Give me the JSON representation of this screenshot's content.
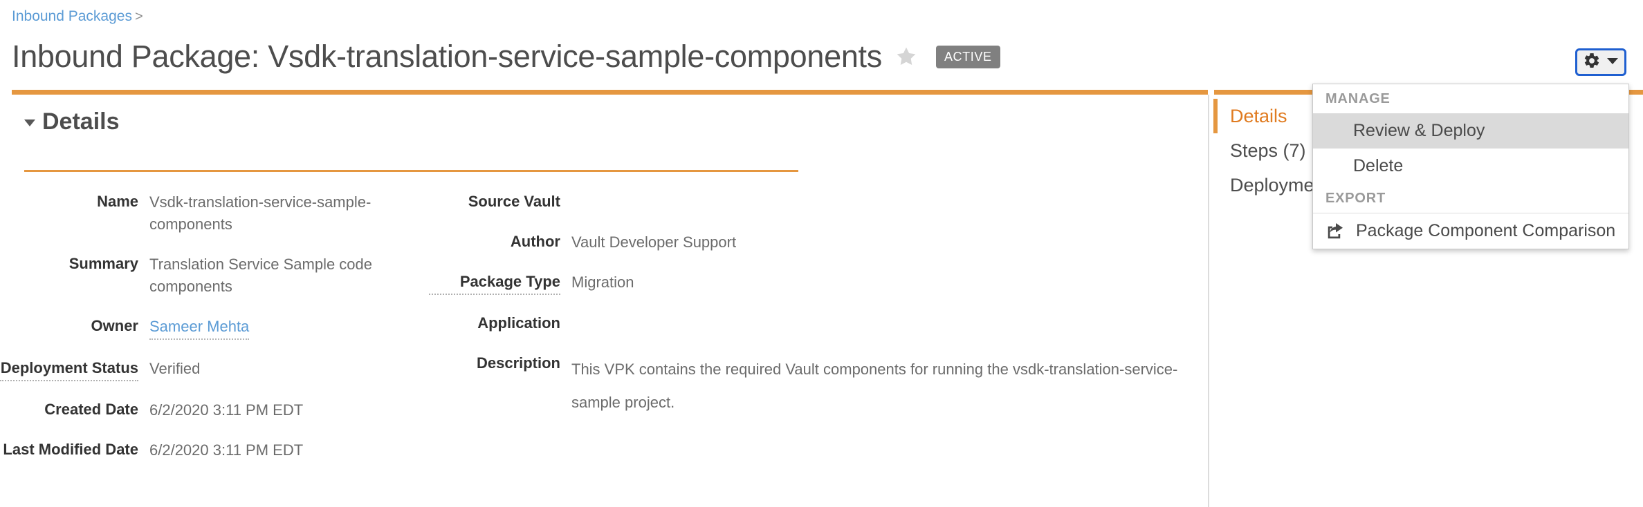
{
  "breadcrumb": {
    "link_label": "Inbound Packages",
    "separator": ">"
  },
  "header": {
    "title": "Inbound Package: Vsdk-translation-service-sample-components",
    "favorite_icon": "star-icon",
    "status_badge": "ACTIVE",
    "actions_button": {
      "gear_icon": "gear-icon",
      "caret_icon": "chevron-down-icon"
    }
  },
  "details": {
    "section_title": "Details",
    "collapse_icon": "caret-down-icon",
    "left_fields": [
      {
        "label": "Name",
        "value": "Vsdk-translation-service-sample-components",
        "style": "text",
        "tooltip": false
      },
      {
        "label": "Summary",
        "value": "Translation Service Sample code components",
        "style": "text",
        "tooltip": false
      },
      {
        "label": "Owner",
        "value": "Sameer Mehta",
        "style": "link",
        "tooltip": false
      },
      {
        "label": "Deployment Status",
        "value": "Verified",
        "style": "text",
        "tooltip": true
      },
      {
        "label": "Created Date",
        "value": "6/2/2020 3:11 PM EDT",
        "style": "text",
        "tooltip": false
      },
      {
        "label": "Last Modified Date",
        "value": "6/2/2020 3:11 PM EDT",
        "style": "text",
        "tooltip": false
      }
    ],
    "right_fields": [
      {
        "label": "Source Vault",
        "value": "",
        "style": "text",
        "tooltip": false
      },
      {
        "label": "Author",
        "value": "Vault Developer Support",
        "style": "text",
        "tooltip": false
      },
      {
        "label": "Package Type",
        "value": "Migration",
        "style": "text",
        "tooltip": true
      },
      {
        "label": "Application",
        "value": "",
        "style": "text",
        "tooltip": false
      },
      {
        "label": "Description",
        "value": "This VPK contains the required Vault components for running the vsdk-translation-service-sample project.",
        "style": "multiline",
        "tooltip": false
      }
    ]
  },
  "rail": {
    "items": [
      {
        "label": "Details",
        "active": true
      },
      {
        "label": "Steps (7)",
        "active": false
      },
      {
        "label": "Deployment",
        "active": false
      }
    ]
  },
  "menu": {
    "groups": [
      {
        "label": "MANAGE",
        "items": [
          {
            "label": "Review & Deploy",
            "highlight": true,
            "icon": null
          },
          {
            "label": "Delete",
            "highlight": false,
            "icon": null
          }
        ]
      },
      {
        "label": "EXPORT",
        "items": [
          {
            "label": "Package Component Comparison",
            "highlight": false,
            "icon": "share-export-icon"
          }
        ]
      }
    ]
  },
  "colors": {
    "accent_orange": "#e59740",
    "active_tab_orange": "#e07b20",
    "link_blue": "#5b9bd5",
    "focus_blue": "#1f5fd0",
    "badge_gray": "#808080"
  }
}
